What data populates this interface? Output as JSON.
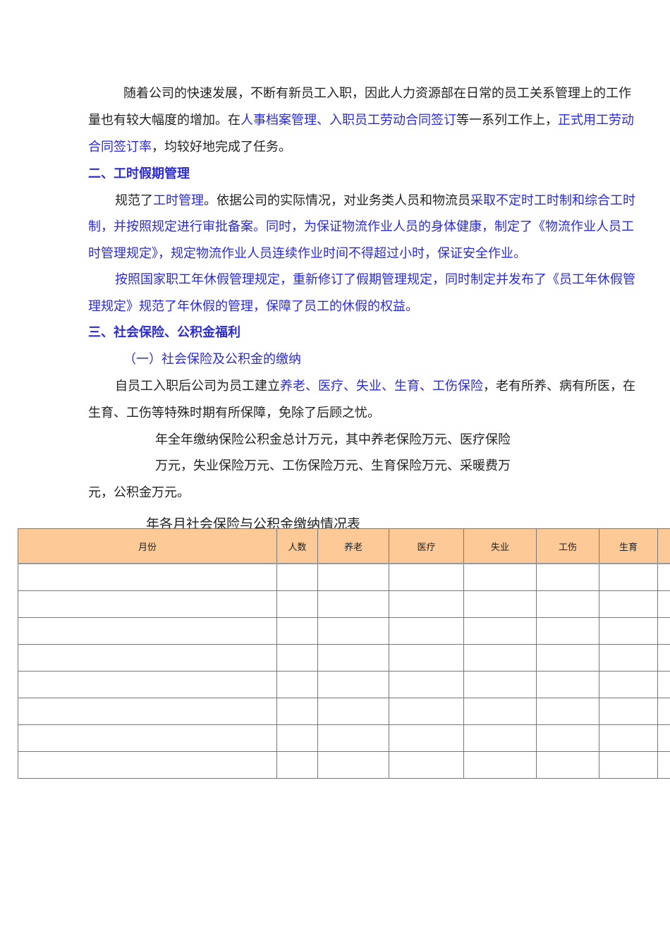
{
  "lines": [
    {
      "runs": [
        {
          "t": "随着公司的快速发展，不断有新员工入职，因此人力资源部在日常的员工关系管理上的工作"
        }
      ]
    },
    {
      "runs": [
        {
          "t": "量也有较大幅度的增加。在"
        },
        {
          "t": "人事档案管理、入职员工劳动合同签订",
          "b": 1
        },
        {
          "t": "等一系列工作上，"
        },
        {
          "t": "正式用工劳动",
          "b": 1
        }
      ]
    },
    {
      "runs": [
        {
          "t": "合同签订率",
          "b": 1
        },
        {
          "t": "，均较好地完成了任务。"
        }
      ]
    },
    {
      "runs": [
        {
          "t": "二、工时假期管理",
          "h": 1
        }
      ]
    },
    {
      "runs": [
        {
          "t": "规范了"
        },
        {
          "t": "工时管理",
          "b": 1
        },
        {
          "t": "。依据公司的实际情况，对业务类人员和物流员"
        },
        {
          "t": "采取不定时工时制和综合工时",
          "b": 1
        }
      ]
    },
    {
      "runs": [
        {
          "t": "制，并按照规定进行审批备案。同时，为保证物流作业人员的身体健康，制定了《物流作业人员工",
          "b": 1
        }
      ]
    },
    {
      "runs": [
        {
          "t": "时管理规定》，规定物流作业人员连续作业时间不得超过小时，保证安全作业。",
          "b": 1
        }
      ]
    },
    {
      "runs": [
        {
          "t": "按照国家职工年休假管理规定，重新修订了假期管理规定，同时制定并发布了《员工年休假管",
          "b": 1
        }
      ]
    },
    {
      "runs": [
        {
          "t": "理规定》规范了年休假的管理，保障了员工的休假的权益。",
          "b": 1
        }
      ]
    },
    {
      "runs": [
        {
          "t": "三、社会保险、公积金福利",
          "h": 1
        }
      ]
    },
    {
      "runs": [
        {
          "t": "（一）社会保险及公积金的缴纳",
          "b": 1
        }
      ]
    },
    {
      "runs": [
        {
          "t": "自员工入职后公司为员工建立"
        },
        {
          "t": "养老、医疗、失业、生育、工伤保险",
          "b": 1
        },
        {
          "t": "，老有所养、病有所医，在"
        }
      ]
    },
    {
      "runs": [
        {
          "t": "生育、工伤等特殊时期有所保障，免除了后顾之忧。"
        }
      ]
    },
    {
      "runs": [
        {
          "t": "年全年缴纳保险公积金总计万元，其中养老保险万元、医疗保险"
        }
      ]
    },
    {
      "runs": [
        {
          "t": "万元，失业保险万元、工伤保险万元、生育保险万元、采暖费万"
        }
      ]
    },
    {
      "runs": [
        {
          "t": "元，公积金万元。"
        }
      ]
    }
  ],
  "table": {
    "title": "年各月社会保险与公积金缴纳情况表",
    "headers": [
      "月份",
      "人数",
      "养老",
      "医疗",
      "失业",
      "工伤",
      "生育",
      ""
    ],
    "row_count": 8
  }
}
